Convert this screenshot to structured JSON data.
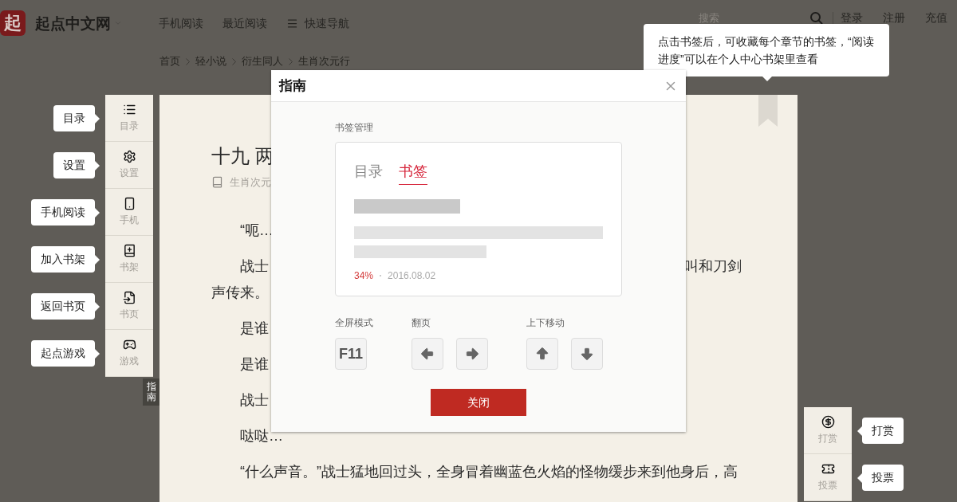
{
  "header": {
    "logo": "起",
    "site_name": "起点中文网",
    "nav": [
      "手机阅读",
      "最近阅读",
      "快速导航"
    ],
    "search": {
      "placeholder": "搜索"
    },
    "links": [
      "登录",
      "注册",
      "充值"
    ]
  },
  "breadcrumb": [
    "首页",
    "轻小说",
    "衍生同人",
    "生肖次元行"
  ],
  "left_toolbar": [
    {
      "label": "目录",
      "callout": "目录"
    },
    {
      "label": "设置",
      "callout": "设置"
    },
    {
      "label": "手机",
      "callout": "手机阅读"
    },
    {
      "label": "书架",
      "callout": "加入书架"
    },
    {
      "label": "书页",
      "callout": "返回书页"
    },
    {
      "label": "游戏",
      "callout": "起点游戏"
    }
  ],
  "guide_tab": "指南",
  "chapter": {
    "title": "十九 两",
    "meta": "生肖次元",
    "paragraphs": [
      {
        "lines": [
          {
            "left": "“呃…"
          }
        ]
      },
      {
        "lines": [
          {
            "left": "战士",
            "right": "叫和刀剑"
          },
          {
            "left": "声传来。"
          }
        ]
      },
      {
        "lines": [
          {
            "left": "是谁"
          }
        ]
      },
      {
        "lines": [
          {
            "left": "是谁"
          }
        ]
      },
      {
        "lines": [
          {
            "left": "战士"
          }
        ]
      },
      {
        "lines": [
          {
            "left": "哒哒…"
          }
        ]
      },
      {
        "lines": [
          {
            "left": "“什么声音。”战士猛地回过头，全身冒着幽蓝色火焰的怪物缓步来到他身后，高"
          }
        ]
      }
    ]
  },
  "tooltip": "点击书签后，可收藏每个章节的书签，“阅读进度”可以在个人中心书架里查看",
  "dialog": {
    "title": "指南",
    "section_label": "书签管理",
    "tabs": [
      {
        "label": "目录",
        "selected": false
      },
      {
        "label": "书签",
        "selected": true
      }
    ],
    "progress": "34%",
    "date": "2016.08.02",
    "key_groups": [
      {
        "label": "全屏模式",
        "keys": [
          {
            "kind": "text",
            "text": "F11"
          }
        ]
      },
      {
        "label": "翻页",
        "keys": [
          {
            "kind": "left"
          },
          {
            "kind": "right"
          }
        ]
      },
      {
        "label": "上下移动",
        "keys": [
          {
            "kind": "up"
          },
          {
            "kind": "down"
          }
        ]
      }
    ],
    "close_button": "关闭"
  },
  "right_toolbar": [
    {
      "label": "打赏",
      "callout": "打赏"
    },
    {
      "label": "投票",
      "callout": "投票"
    }
  ]
}
